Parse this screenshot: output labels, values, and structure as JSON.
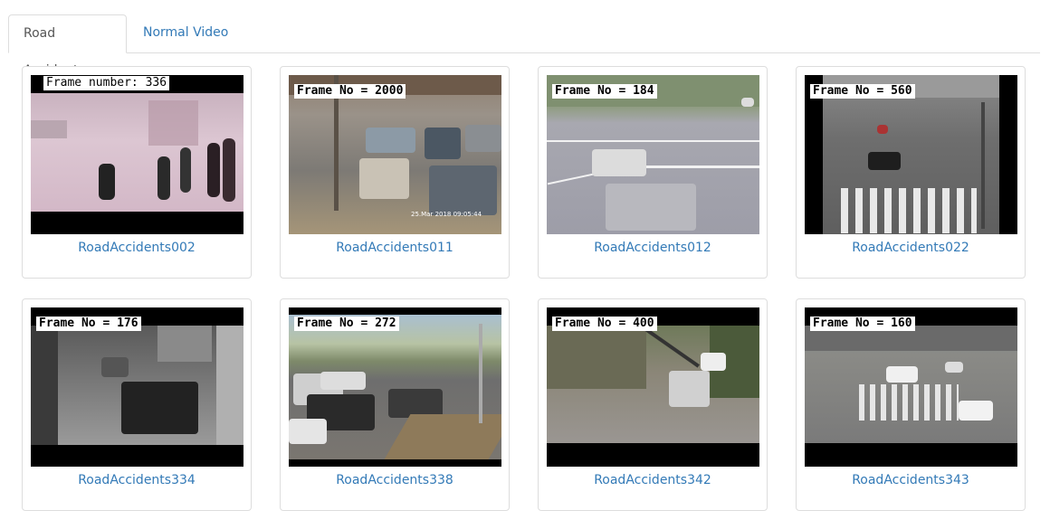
{
  "tabs": [
    {
      "label": "Road Accident",
      "active": true
    },
    {
      "label": "Normal Video",
      "active": false
    }
  ],
  "videos": [
    {
      "name": "RoadAccidents002",
      "frame_label": "Frame number: 336"
    },
    {
      "name": "RoadAccidents011",
      "frame_label": "Frame No = 2000",
      "timestamp": "25.Mar 2018  09:05:44"
    },
    {
      "name": "RoadAccidents012",
      "frame_label": "Frame No = 184"
    },
    {
      "name": "RoadAccidents022",
      "frame_label": "Frame No = 560"
    },
    {
      "name": "RoadAccidents334",
      "frame_label": "Frame No = 176"
    },
    {
      "name": "RoadAccidents338",
      "frame_label": "Frame No = 272"
    },
    {
      "name": "RoadAccidents342",
      "frame_label": "Frame No = 400"
    },
    {
      "name": "RoadAccidents343",
      "frame_label": "Frame No = 160"
    }
  ],
  "colors": {
    "link": "#337ab7",
    "border": "#dddddd"
  }
}
